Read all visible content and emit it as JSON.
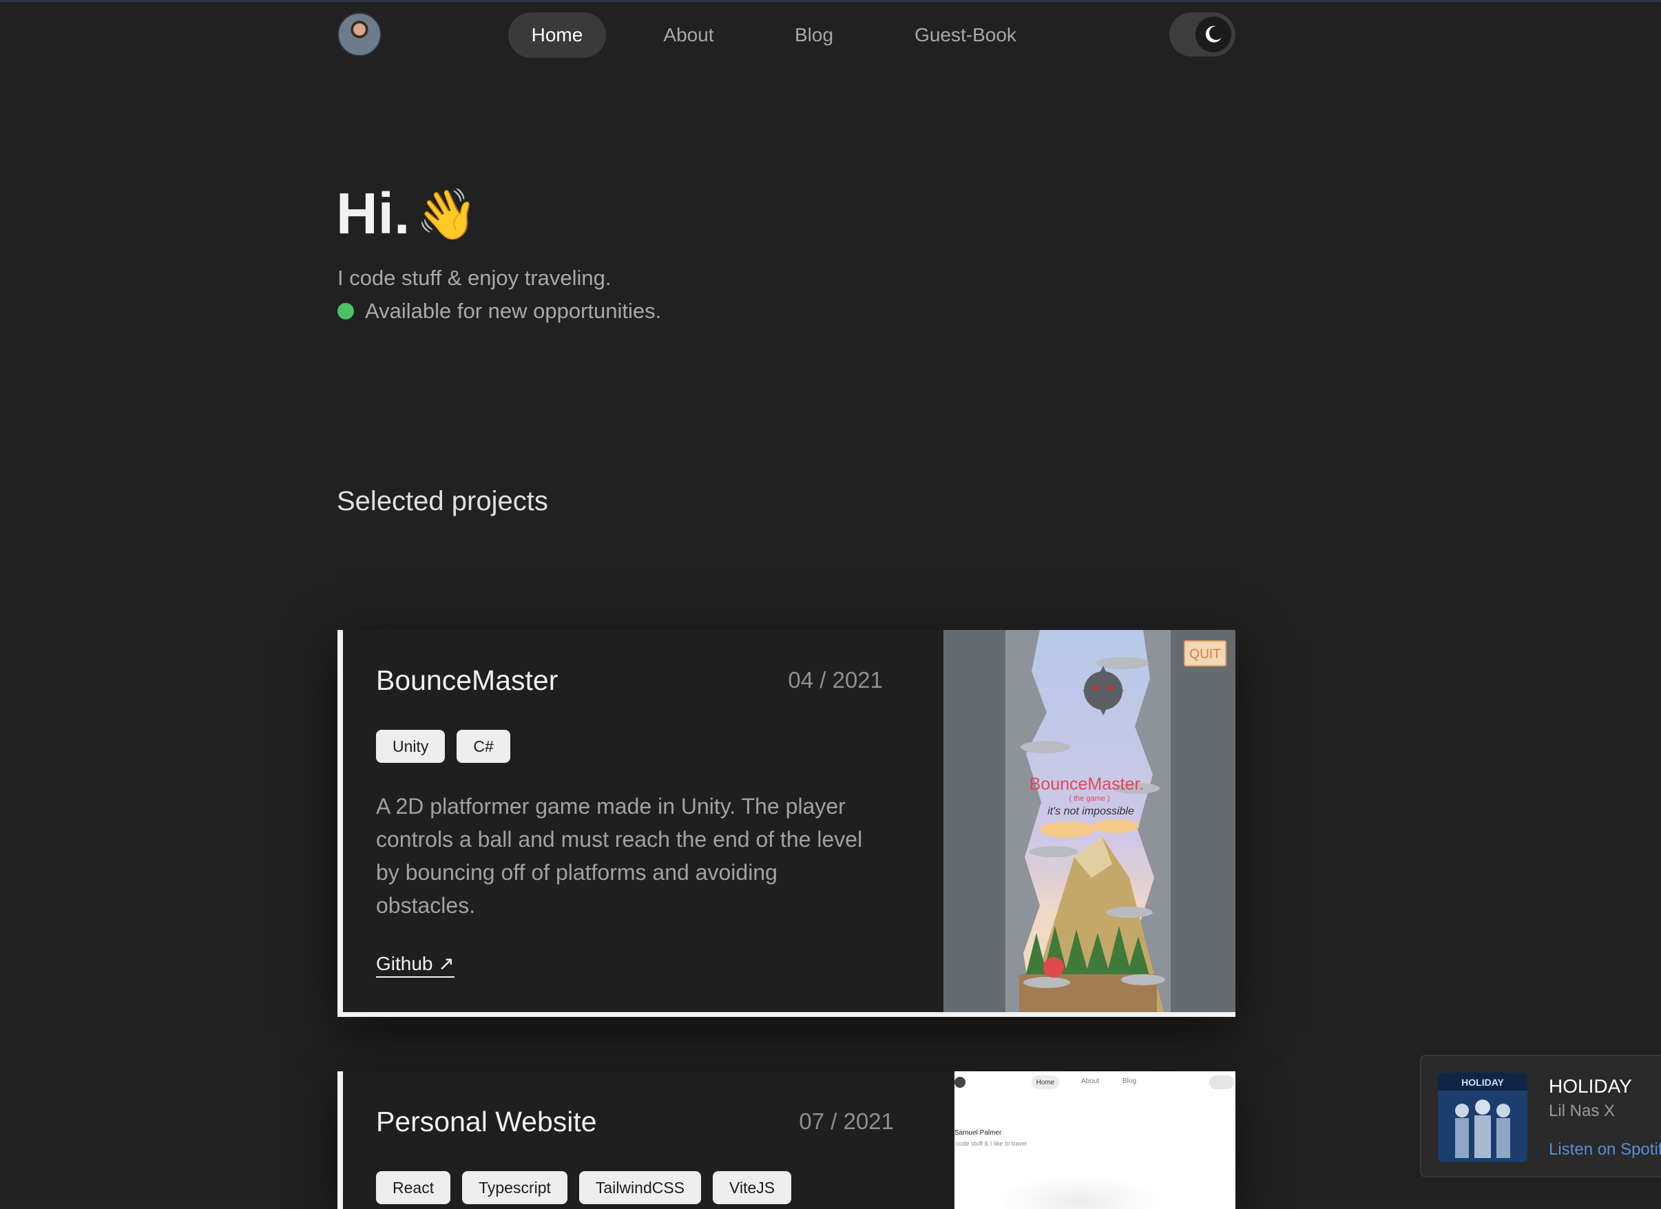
{
  "nav": {
    "items": [
      {
        "label": "Home",
        "active": true
      },
      {
        "label": "About",
        "active": false
      },
      {
        "label": "Blog",
        "active": false
      },
      {
        "label": "Guest-Book",
        "active": false
      }
    ],
    "theme_toggle_icon": "moon-icon"
  },
  "hero": {
    "greeting": "Hi.",
    "wave": "👋",
    "tagline": "I code stuff & enjoy traveling.",
    "availability": "Available for new opportunities.",
    "availability_color": "#4cc264"
  },
  "projects": {
    "section_title": "Selected projects",
    "items": [
      {
        "title": "BounceMaster",
        "date": "04 / 2021",
        "tags": [
          "Unity",
          "C#"
        ],
        "description": "A 2D platformer game made in Unity. The player controls a ball and must reach the end of the level by bouncing off of platforms and avoiding obstacles.",
        "link_label": "Github ↗",
        "screenshot": {
          "quit_label": "QUIT",
          "game_title": "BounceMaster.",
          "game_subtitle": "( the game )",
          "game_tagline": "it's not impossible"
        }
      },
      {
        "title": "Personal Website",
        "date": "07 / 2021",
        "tags": [
          "React",
          "Typescript",
          "TailwindCSS",
          "ViteJS"
        ],
        "screenshot": {
          "nav": [
            "Home",
            "About",
            "Blog"
          ],
          "name": "Samuel Palmer",
          "tagline": "code stuff & I like to travel"
        }
      }
    ]
  },
  "music": {
    "title": "HOLIDAY",
    "artist": "Lil Nas X",
    "link_label": "Listen on Spotify"
  }
}
